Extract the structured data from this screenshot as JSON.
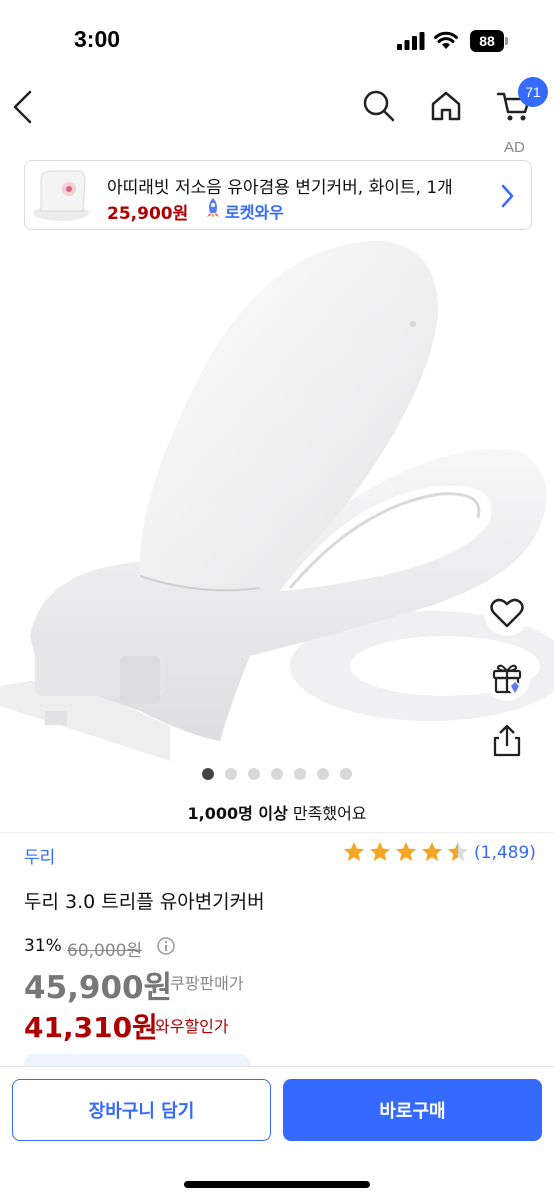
{
  "status_bar": {
    "time": "3:00",
    "battery": "88"
  },
  "nav": {
    "cart_count": "71"
  },
  "ad": {
    "label": "AD",
    "title": "아띠래빗 저소음 유아겸용 변기커버, 화이트, 1개",
    "price": "25,900원",
    "rocket_label": "로켓와우"
  },
  "gallery": {
    "total_images": 7,
    "active_index": 0
  },
  "satisfaction": {
    "bold": "1,000명 이상",
    "rest": " 만족했어요"
  },
  "product": {
    "brand": "두리",
    "rating": 4.5,
    "rating_count": "(1,489)",
    "title": "두리 3.0 트리플 유아변기커버",
    "discount_rate": "31%",
    "original_price": "60,000원",
    "coupang_price": "45,900원",
    "coupang_label": "쿠팡판매가",
    "wow_price": "41,310원",
    "wow_label": "와우할인가"
  },
  "bottom_bar": {
    "cart_button": "장바구니 담기",
    "buy_button": "바로구매"
  },
  "colors": {
    "accent": "#346aff",
    "price_red": "#ae0000",
    "star": "#f5a623"
  }
}
